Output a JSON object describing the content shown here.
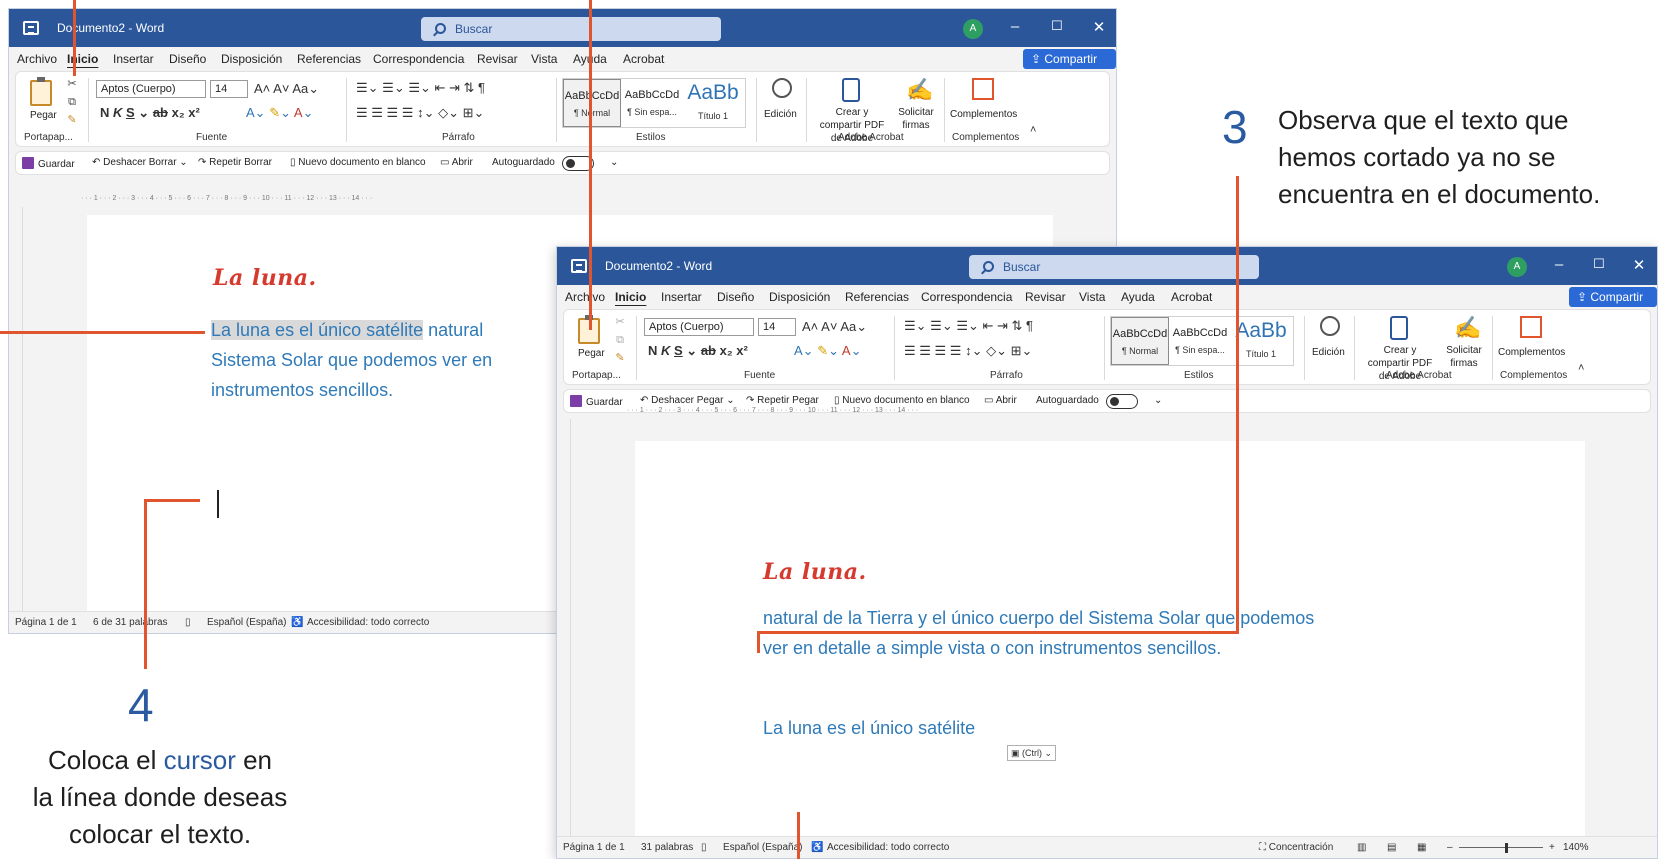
{
  "window_a": {
    "title": "Documento2  -  Word",
    "search_placeholder": "Buscar",
    "avatar_initial": "A",
    "menu_tabs": [
      "Archivo",
      "Inicio",
      "Insertar",
      "Diseño",
      "Disposición",
      "Referencias",
      "Correspondencia",
      "Revisar",
      "Vista",
      "Ayuda",
      "Acrobat"
    ],
    "share_label": "Compartir",
    "ribbon": {
      "paste_label": "Pegar",
      "clipboard_group": "Portapap...",
      "font_name": "Aptos (Cuerpo)",
      "font_size": "14",
      "font_group": "Fuente",
      "paragraph_group": "Párrafo",
      "styles": [
        {
          "sample": "AaBbCcDd",
          "name": "¶ Normal"
        },
        {
          "sample": "AaBbCcDd",
          "name": "¶ Sin espa..."
        },
        {
          "sample": "AaBb",
          "name": "Título 1"
        }
      ],
      "styles_group": "Estilos",
      "editing_label": "Edición",
      "acrobat_create": "Crear y compartir PDF de Adobe",
      "acrobat_sign": "Solicitar firmas",
      "acrobat_group": "Adobe Acrobat",
      "addins_label": "Complementos",
      "addins_group": "Complementos"
    },
    "qat": {
      "save": "Guardar",
      "undo": "Deshacer Borrar",
      "redo": "Repetir Borrar",
      "new_blank": "Nuevo documento en blanco",
      "open": "Abrir",
      "autosave": "Autoguardado"
    },
    "ruler_text": "· · · 1 · · · 2 · · · 3 · · · 4 · · · 5 · · · 6 · · · 7 · · · 8 · · · 9 · · · 10 · · · 11 · · · 12 · · · 13 · · · 14 · · ·",
    "document": {
      "heading": "La luna.",
      "line1_selected": "La luna es el único satélite",
      "line1_rest": " natural",
      "line2": "Sistema Solar que podemos ver en",
      "line3": "instrumentos sencillos."
    },
    "status": {
      "page": "Página 1 de 1",
      "words": "6 de 31 palabras",
      "language": "Español (España)",
      "accessibility": "Accesibilidad: todo correcto"
    }
  },
  "window_b": {
    "title": "Documento2  -  Word",
    "search_placeholder": "Buscar",
    "avatar_initial": "A",
    "menu_tabs": [
      "Archivo",
      "Inicio",
      "Insertar",
      "Diseño",
      "Disposición",
      "Referencias",
      "Correspondencia",
      "Revisar",
      "Vista",
      "Ayuda",
      "Acrobat"
    ],
    "share_label": "Compartir",
    "ribbon": {
      "paste_label": "Pegar",
      "clipboard_group": "Portapap...",
      "font_name": "Aptos (Cuerpo)",
      "font_size": "14",
      "font_group": "Fuente",
      "paragraph_group": "Párrafo",
      "styles": [
        {
          "sample": "AaBbCcDd",
          "name": "¶ Normal"
        },
        {
          "sample": "AaBbCcDd",
          "name": "¶ Sin espa..."
        },
        {
          "sample": "AaBb",
          "name": "Título 1"
        }
      ],
      "styles_group": "Estilos",
      "editing_label": "Edición",
      "acrobat_create": "Crear y compartir PDF de Adobe",
      "acrobat_sign": "Solicitar firmas",
      "acrobat_group": "Adobe Acrobat",
      "addins_label": "Complementos",
      "addins_group": "Complementos"
    },
    "qat": {
      "save": "Guardar",
      "undo": "Deshacer Pegar",
      "redo": "Repetir Pegar",
      "new_blank": "Nuevo documento en blanco",
      "open": "Abrir",
      "autosave": "Autoguardado"
    },
    "ruler_text": "· · · 1 · · · 2 · · · 3 · · · 4 · · · 5 · · · 6 · · · 7 · · · 8 · · · 9 · · · 10 · · · 11 · · · 12 · · · 13 · · · 14 · · ·",
    "document": {
      "heading": "La luna.",
      "line1": "natural de la Tierra y el único cuerpo del Sistema Solar que podemos",
      "line2": "ver en detalle a simple vista o con instrumentos sencillos.",
      "pasted": "La luna es el único satélite",
      "paste_options": "(Ctrl)"
    },
    "status": {
      "page": "Página 1 de 1",
      "words": "31 palabras",
      "language": "Español (España)",
      "accessibility": "Accesibilidad: todo correcto",
      "focus": "Concentración",
      "zoom": "140%"
    }
  },
  "annotations": {
    "step3_number": "3",
    "step3_text": [
      "Observa que el texto que",
      "hemos cortado ya no se",
      "encuentra en el documento."
    ],
    "step4_number": "4",
    "step4_text_before": "Coloca el ",
    "step4_text_accent": "cursor",
    "step4_text_after": " en",
    "step4_text_line2": "la línea donde deseas",
    "step4_text_line3": "colocar el texto."
  },
  "colors": {
    "word_blue": "#2b579a",
    "annotation_line": "#e0552e",
    "annotation_number": "#2a5aa0",
    "doc_text": "#2f7ab8",
    "doc_heading": "#d63a2f"
  }
}
